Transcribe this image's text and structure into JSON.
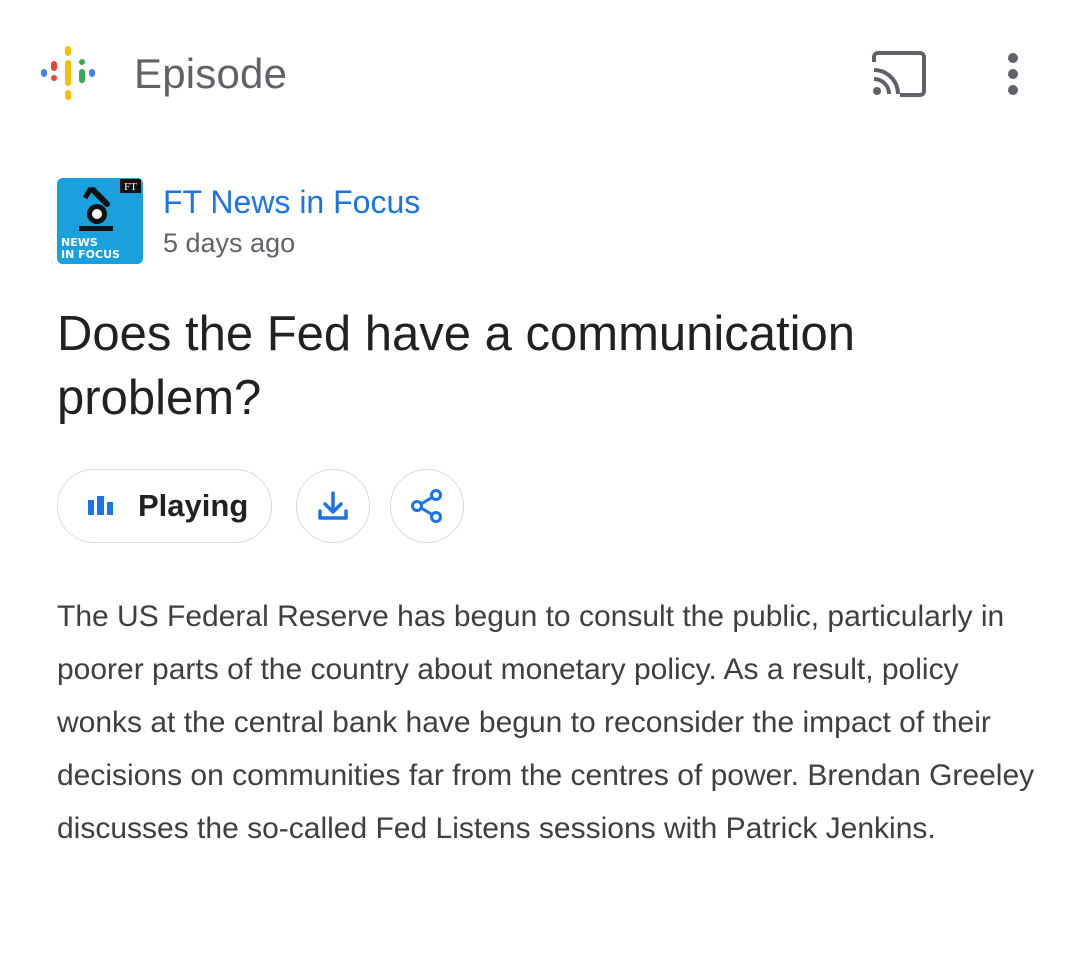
{
  "header": {
    "title": "Episode",
    "cast_icon": "cast-icon",
    "more_icon": "more-vert-icon",
    "logo_icon": "google-podcasts-logo-icon",
    "logo_colors": [
      "#4285f4",
      "#ea4335",
      "#fbbc04",
      "#34a853"
    ]
  },
  "podcast": {
    "name": "FT News in Focus",
    "age": "5 days ago",
    "art_label_line1": "NEWS",
    "art_label_line2": "IN FOCUS",
    "art_badge": "FT",
    "art_color": "#1aa0dc"
  },
  "episode": {
    "title": "Does the Fed have a communication problem?",
    "description": "The US Federal Reserve has begun to consult the public, particularly in poorer parts of the country about monetary policy. As a result, policy wonks at the central bank have begun to reconsider the impact of their decisions on communities far from the centres of power. Brendan Greeley discusses the so-called Fed Listens sessions with Patrick Jenkins."
  },
  "actions": {
    "play_label": "Playing",
    "play_icon": "equalizer-icon",
    "download_icon": "download-icon",
    "share_icon": "share-icon",
    "accent_color": "#1a73e8"
  }
}
